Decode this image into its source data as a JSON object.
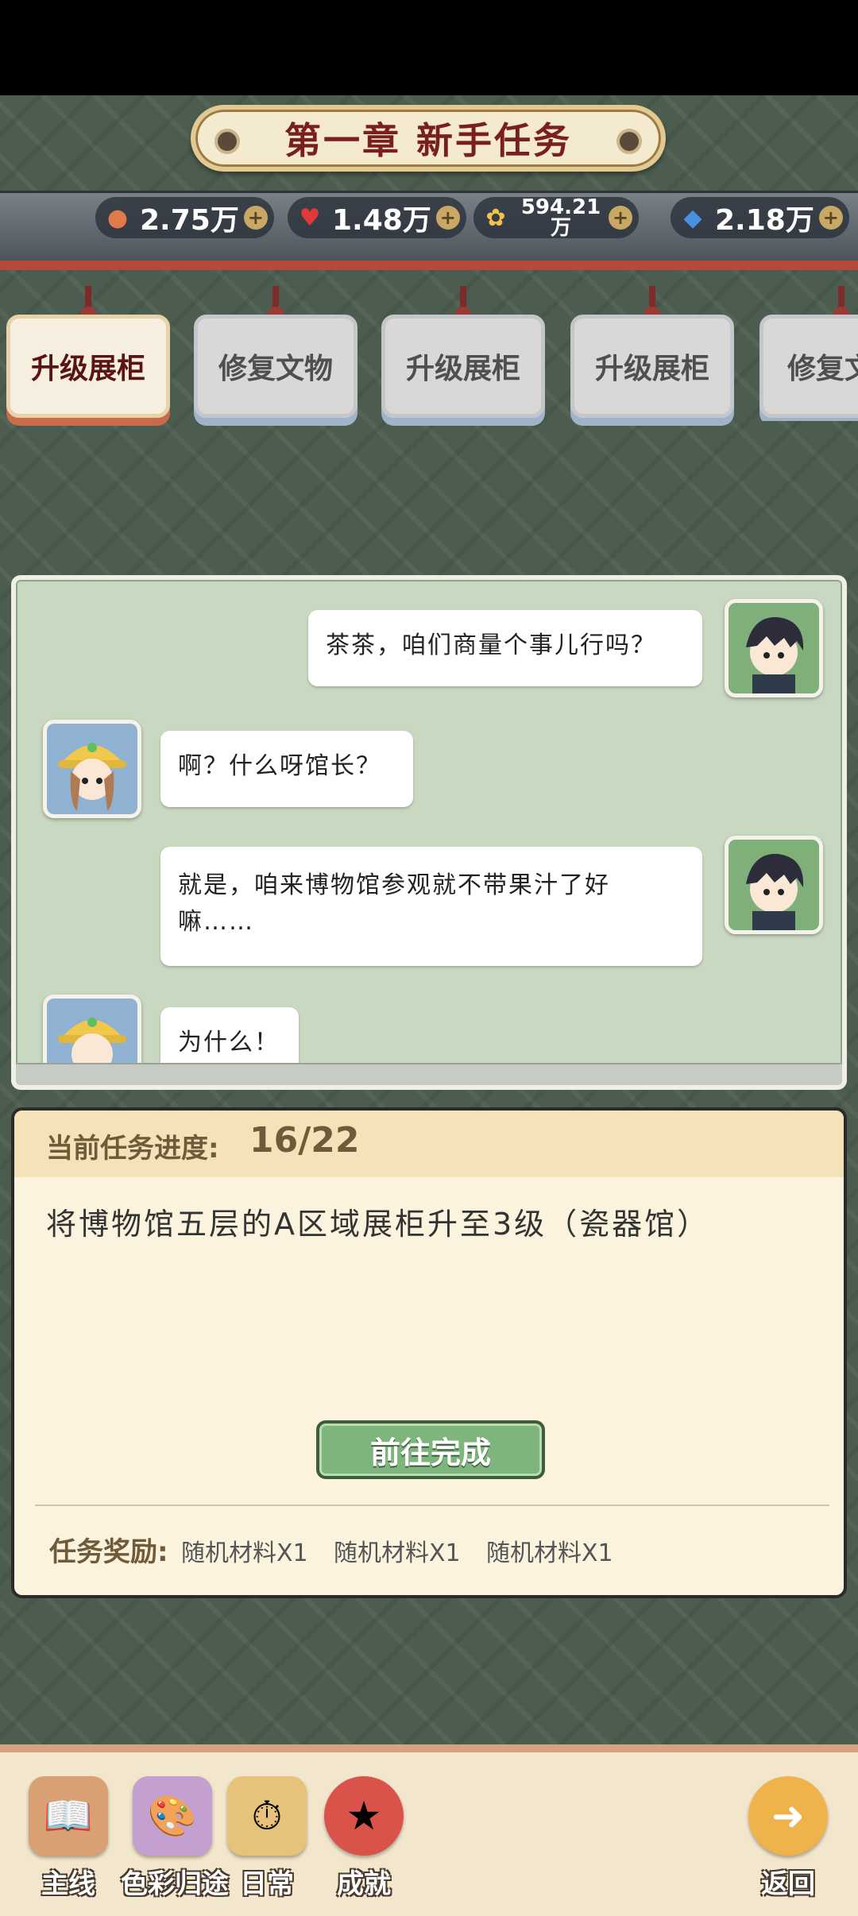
{
  "chapter": {
    "title": "第一章 新手任务"
  },
  "resources": [
    {
      "icon": "orange-pin-icon",
      "value": "2.75万"
    },
    {
      "icon": "heart-icon",
      "value": "1.48万"
    },
    {
      "icon": "flower-coin-icon",
      "value": "594.21万"
    },
    {
      "icon": "blue-gem-icon",
      "value": "2.18万"
    }
  ],
  "tabs": [
    {
      "label": "升级展柜",
      "active": true
    },
    {
      "label": "修复文物",
      "active": false
    },
    {
      "label": "升级展柜",
      "active": false
    },
    {
      "label": "升级展柜",
      "active": false
    },
    {
      "label": "修复文物",
      "active": false
    }
  ],
  "dialog": [
    {
      "speaker": "curator",
      "text": "茶茶，咱们商量个事儿行吗？"
    },
    {
      "speaker": "chacha",
      "text": "啊？什么呀馆长？"
    },
    {
      "speaker": "curator",
      "text": "就是，咱来博物馆参观就不带果汁了好嘛……"
    },
    {
      "speaker": "chacha",
      "text": "为什么！"
    }
  ],
  "task": {
    "progress_label": "当前任务进度:",
    "progress_value": "16/22",
    "description": "将博物馆五层的A区域展柜升至3级（瓷器馆）",
    "go_button": "前往完成",
    "reward_label": "任务奖励:",
    "rewards": [
      "随机材料X1",
      "随机材料X1",
      "随机材料X1"
    ]
  },
  "nav": [
    {
      "label": "主线",
      "icon": "script-book-icon"
    },
    {
      "label": "色彩归途",
      "icon": "easel-icon"
    },
    {
      "label": "日常",
      "icon": "clock-icon"
    },
    {
      "label": "成就",
      "icon": "medal-icon"
    },
    {
      "label": "返回",
      "icon": "back-arrow-icon"
    }
  ]
}
